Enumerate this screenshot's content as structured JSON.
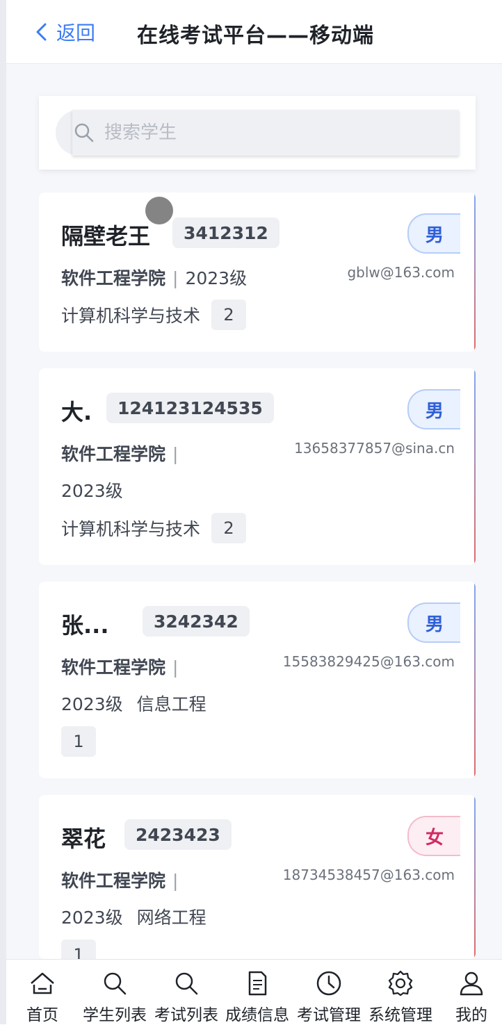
{
  "header": {
    "back_label": "返回",
    "title": "在线考试平台——移动端"
  },
  "search": {
    "placeholder": "搜索学生"
  },
  "students": [
    {
      "name": "隔壁老王",
      "id": "3412312",
      "gender": "男",
      "college": "软件工程学院",
      "grade": "2023级",
      "email": "gblw@163.com",
      "major": "计算机科学与技术",
      "class": "2"
    },
    {
      "name": "大.",
      "id": "124123124535",
      "gender": "男",
      "college": "软件工程学院",
      "grade": "2023级",
      "email": "13658377857@sina.cn",
      "major": "计算机科学与技术",
      "class": "2"
    },
    {
      "name": "张...",
      "id": "3242342",
      "gender": "男",
      "college": "软件工程学院",
      "grade": "2023级",
      "email": "15583829425@163.com",
      "major": "信息工程",
      "class": "1"
    },
    {
      "name": "翠花",
      "id": "2423423",
      "gender": "女",
      "college": "软件工程学院",
      "grade": "2023级",
      "email": "18734538457@163.com",
      "major": "网络工程",
      "class": "1"
    }
  ],
  "nav": [
    {
      "label": "首页",
      "icon": "home-icon"
    },
    {
      "label": "学生列表",
      "icon": "search-icon"
    },
    {
      "label": "考试列表",
      "icon": "search-icon"
    },
    {
      "label": "成绩信息",
      "icon": "document-icon"
    },
    {
      "label": "考试管理",
      "icon": "clock-icon"
    },
    {
      "label": "系统管理",
      "icon": "gear-icon"
    },
    {
      "label": "我的",
      "icon": "user-icon"
    }
  ],
  "colors": {
    "accent": "#3b7cf5",
    "male": "#2f5fd8",
    "female": "#d12a62"
  }
}
